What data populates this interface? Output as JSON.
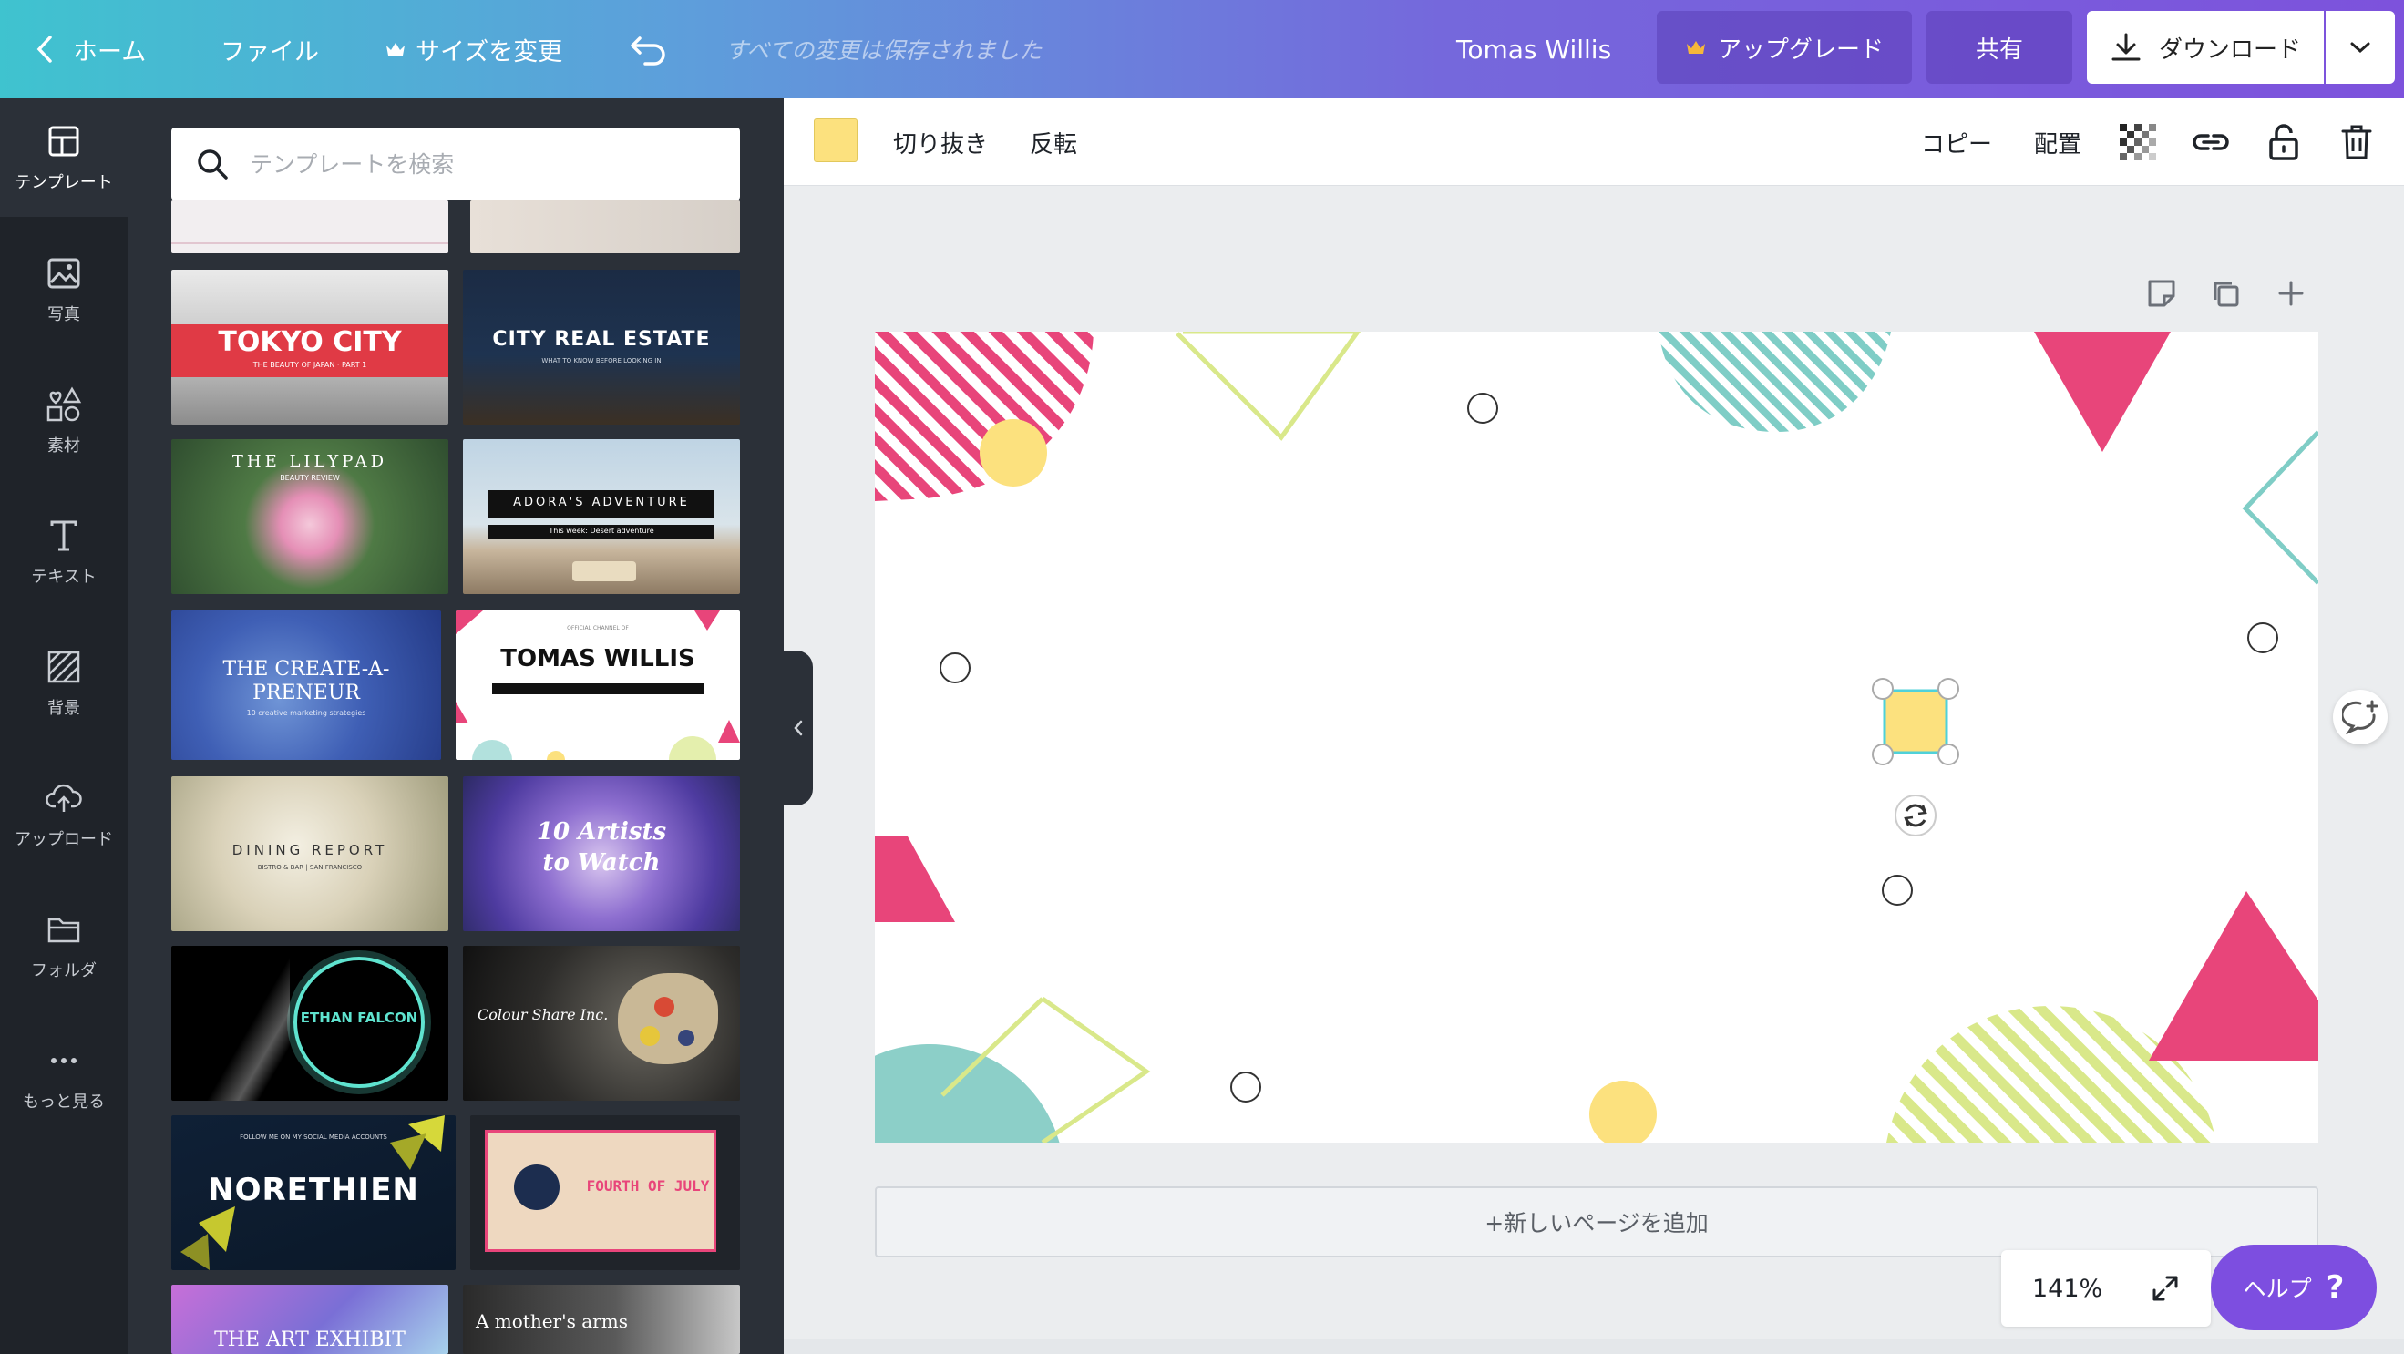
{
  "topbar": {
    "home_label": "ホーム",
    "file_label": "ファイル",
    "resize_label": "サイズを変更",
    "saved_status": "すべての変更は保存されました",
    "user_name": "Tomas Willis",
    "upgrade_label": "アップグレード",
    "share_label": "共有",
    "download_label": "ダウンロード"
  },
  "sidebar": {
    "items": [
      {
        "label": "テンプレート",
        "icon": "layout-icon"
      },
      {
        "label": "写真",
        "icon": "photo-icon"
      },
      {
        "label": "素材",
        "icon": "elements-icon"
      },
      {
        "label": "テキスト",
        "icon": "text-icon"
      },
      {
        "label": "背景",
        "icon": "background-icon"
      },
      {
        "label": "アップロード",
        "icon": "upload-icon"
      },
      {
        "label": "フォルダ",
        "icon": "folder-icon"
      },
      {
        "label": "もっと見る",
        "icon": "more-icon"
      }
    ]
  },
  "templates": {
    "search_placeholder": "テンプレートを検索",
    "items": [
      {
        "title": "TOKYO CITY",
        "subtitle": "THE BEAUTY OF JAPAN · PART 1"
      },
      {
        "title": "CITY REAL ESTATE",
        "subtitle": "WHAT TO KNOW BEFORE LOOKING IN"
      },
      {
        "title": "THE LILYPAD",
        "subtitle": "BEAUTY REVIEW"
      },
      {
        "title": "ADORA'S ADVENTURE",
        "subtitle": "This week: Desert adventure"
      },
      {
        "title": "THE CREATE-A-PRENEUR",
        "subtitle": "10 creative marketing strategies"
      },
      {
        "title": "TOMAS WILLIS",
        "subtitle": "OFFICIAL CHANNEL OF"
      },
      {
        "title": "DINING REPORT",
        "subtitle": "BISTRO & BAR | SAN FRANCISCO"
      },
      {
        "title": "10 Artists to Watch",
        "subtitle": ""
      },
      {
        "title": "ETHAN FALCON",
        "subtitle": ""
      },
      {
        "title": "Colour Share Inc.",
        "subtitle": ""
      },
      {
        "title": "NORETHIEN",
        "subtitle": "FOLLOW ME ON MY SOCIAL MEDIA ACCOUNTS"
      },
      {
        "title": "FOURTH OF JULY",
        "subtitle": ""
      },
      {
        "title": "THE ART EXHIBIT",
        "subtitle": ""
      },
      {
        "title": "A mother's arms",
        "subtitle": ""
      }
    ]
  },
  "toolbar": {
    "swatch_color": "#fce17e",
    "crop_label": "切り抜き",
    "flip_label": "反転",
    "copy_label": "コピー",
    "arrange_label": "配置"
  },
  "canvas": {
    "add_page_label": "+新しいページを追加",
    "zoom": "141%",
    "help_label": "ヘルプ",
    "help_icon": "?"
  },
  "colors": {
    "pink": "#e8457a",
    "teal": "#7fcdc6",
    "lime": "#d9e88a",
    "yellow": "#fce17e",
    "accent": "#7d4ee0"
  }
}
